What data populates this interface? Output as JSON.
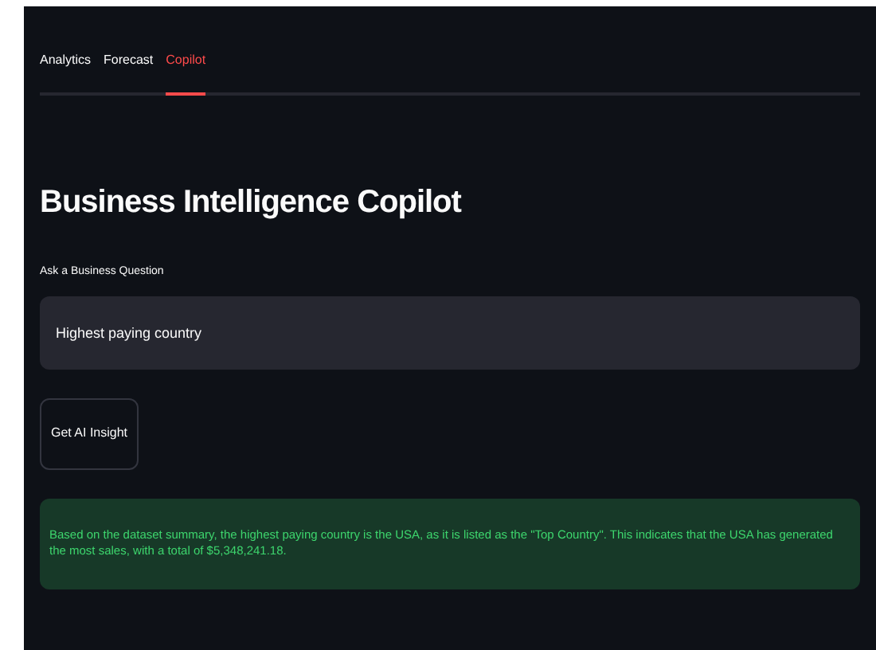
{
  "tabs": [
    {
      "label": "Analytics",
      "selected": false
    },
    {
      "label": "Forecast",
      "selected": false
    },
    {
      "label": "Copilot",
      "selected": true
    }
  ],
  "title": "Business Intelligence Copilot",
  "question": {
    "label": "Ask a Business Question",
    "value": "Highest paying country"
  },
  "button": "Get AI Insight",
  "answer": "Based on the dataset summary, the highest paying country is the USA, as it is listed as the \"Top Country\". This indicates that the USA has generated the most sales, with a total of $5,348,241.18."
}
